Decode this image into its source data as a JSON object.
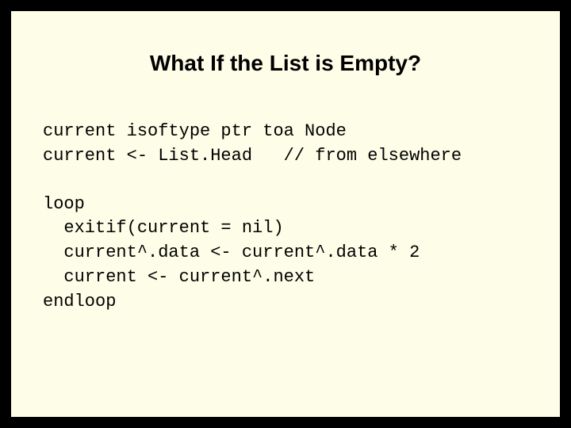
{
  "slide": {
    "title": "What If the List is Empty?",
    "code1": "current isoftype ptr toa Node\ncurrent <- List.Head   // from elsewhere",
    "code2": "loop\n  exitif(current = nil)\n  current^.data <- current^.data * 2\n  current <- current^.next\nendloop"
  }
}
